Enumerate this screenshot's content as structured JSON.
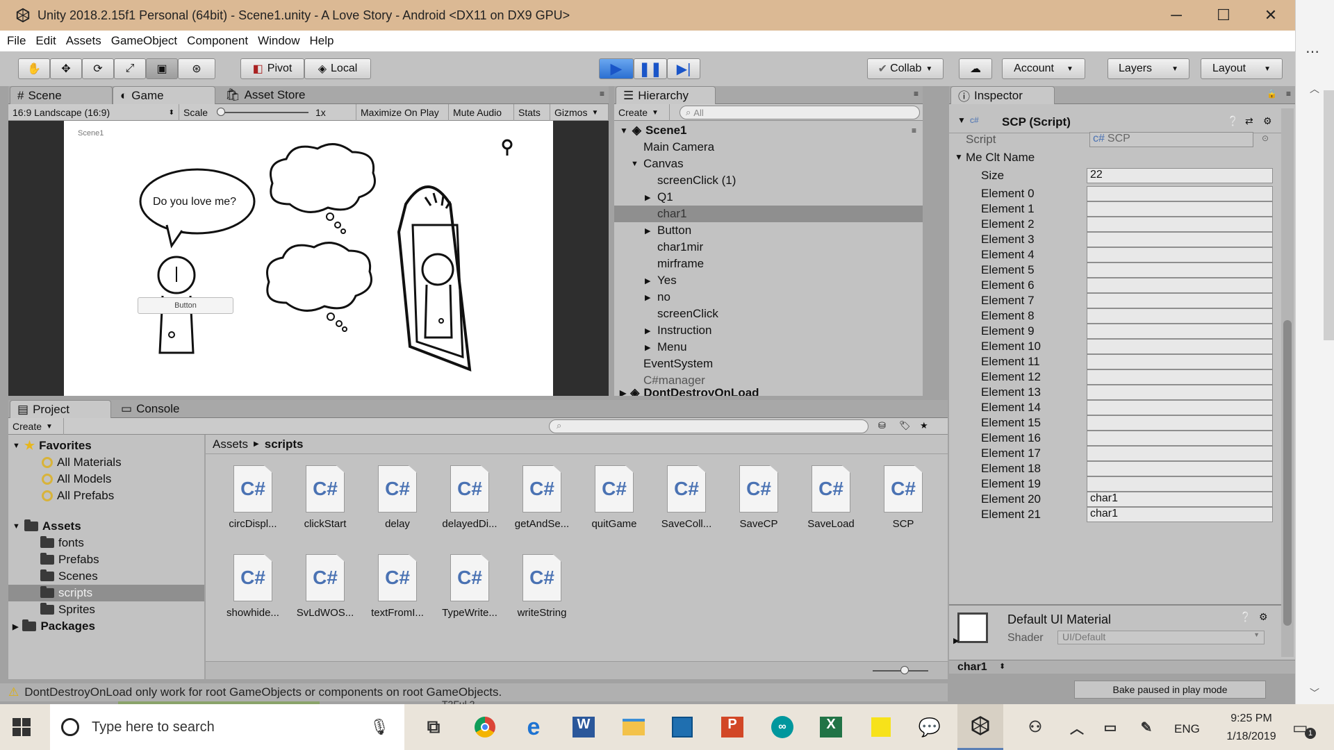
{
  "window": {
    "title": "Unity 2018.2.15f1 Personal (64bit) - Scene1.unity - A Love Story - Android <DX11 on DX9 GPU>",
    "minimize": "─",
    "maximize": "☐",
    "close": "✕"
  },
  "menu": [
    "File",
    "Edit",
    "Assets",
    "GameObject",
    "Component",
    "Window",
    "Help"
  ],
  "toolbar": {
    "pivot": "Pivot",
    "local": "Local",
    "collab": "Collab",
    "account": "Account",
    "layers": "Layers",
    "layout": "Layout"
  },
  "scene_panel": {
    "tabs": [
      "Scene",
      "Game",
      "Asset Store"
    ],
    "aspect": "16:9 Landscape (16:9)",
    "scale_label": "Scale",
    "scale_value": "1x",
    "maximize": "Maximize On Play",
    "mute": "Mute Audio",
    "stats": "Stats",
    "gizmos": "Gizmos",
    "game_label": "Scene1",
    "bubble_text": "Do you love me?",
    "button_text": "Button"
  },
  "hierarchy": {
    "tab": "Hierarchy",
    "create": "Create",
    "search_placeholder": "All",
    "scene": "Scene1",
    "items": [
      {
        "label": "Main Camera",
        "indent": 1,
        "arrow": ""
      },
      {
        "label": "Canvas",
        "indent": 1,
        "arrow": "▼"
      },
      {
        "label": "screenClick (1)",
        "indent": 2,
        "arrow": ""
      },
      {
        "label": "Q1",
        "indent": 2,
        "arrow": "▶"
      },
      {
        "label": "char1",
        "indent": 2,
        "arrow": ""
      },
      {
        "label": "Button",
        "indent": 2,
        "arrow": "▶"
      },
      {
        "label": "char1mir",
        "indent": 2,
        "arrow": ""
      },
      {
        "label": "mirframe",
        "indent": 2,
        "arrow": ""
      },
      {
        "label": "Yes",
        "indent": 2,
        "arrow": "▶"
      },
      {
        "label": "no",
        "indent": 2,
        "arrow": "▶"
      },
      {
        "label": "screenClick",
        "indent": 2,
        "arrow": ""
      },
      {
        "label": "Instruction",
        "indent": 2,
        "arrow": "▶"
      },
      {
        "label": "Menu",
        "indent": 2,
        "arrow": "▶"
      },
      {
        "label": "EventSystem",
        "indent": 1,
        "arrow": ""
      },
      {
        "label": "C#manager",
        "indent": 1,
        "arrow": ""
      }
    ],
    "dont_destroy": "DontDestroyOnLoad"
  },
  "inspector": {
    "tab": "Inspector",
    "component": "SCP (Script)",
    "script_label": "Script",
    "script_value": "SCP",
    "list_name": "Me Clt Name",
    "size_label": "Size",
    "size_value": "22",
    "elements": [
      {
        "label": "Element 0",
        "value": ""
      },
      {
        "label": "Element 1",
        "value": ""
      },
      {
        "label": "Element 2",
        "value": ""
      },
      {
        "label": "Element 3",
        "value": ""
      },
      {
        "label": "Element 4",
        "value": ""
      },
      {
        "label": "Element 5",
        "value": ""
      },
      {
        "label": "Element 6",
        "value": ""
      },
      {
        "label": "Element 7",
        "value": ""
      },
      {
        "label": "Element 8",
        "value": ""
      },
      {
        "label": "Element 9",
        "value": ""
      },
      {
        "label": "Element 10",
        "value": ""
      },
      {
        "label": "Element 11",
        "value": ""
      },
      {
        "label": "Element 12",
        "value": ""
      },
      {
        "label": "Element 13",
        "value": ""
      },
      {
        "label": "Element 14",
        "value": ""
      },
      {
        "label": "Element 15",
        "value": ""
      },
      {
        "label": "Element 16",
        "value": ""
      },
      {
        "label": "Element 17",
        "value": ""
      },
      {
        "label": "Element 18",
        "value": ""
      },
      {
        "label": "Element 19",
        "value": ""
      },
      {
        "label": "Element 20",
        "value": "char1"
      },
      {
        "label": "Element 21",
        "value": "char1"
      }
    ],
    "material": "Default UI Material",
    "shader_label": "Shader",
    "shader_value": "UI/Default",
    "footer": "char1",
    "bake": "Bake paused in play mode"
  },
  "project": {
    "tabs": [
      "Project",
      "Console"
    ],
    "create": "Create",
    "favorites_label": "Favorites",
    "favorites": [
      "All Materials",
      "All Models",
      "All Prefabs"
    ],
    "assets_label": "Assets",
    "folders": [
      "fonts",
      "Prefabs",
      "Scenes",
      "scripts",
      "Sprites"
    ],
    "packages_label": "Packages",
    "breadcrumb_root": "Assets",
    "breadcrumb_leaf": "scripts",
    "file_badge": "C#",
    "files": [
      "circDispl...",
      "clickStart",
      "delay",
      "delayedDi...",
      "getAndSe...",
      "quitGame",
      "SaveColl...",
      "SaveCP",
      "SaveLoad",
      "SCP",
      "showhide...",
      "SvLdWOS...",
      "textFromI...",
      "TypeWrite...",
      "writeString"
    ]
  },
  "status": {
    "warning": "DontDestroyOnLoad only work for root GameObjects or components on root GameObjects."
  },
  "taskbar": {
    "search_placeholder": "Type here to search",
    "lang": "ENG",
    "time": "9:25 PM",
    "date": "1/18/2019",
    "notification_count": "1",
    "desktop_peek": "T2Ful 2"
  },
  "colors": {
    "unity_bg": "#a2a2a2",
    "play_blue": "#2b7de9",
    "titlebar": "#dbb994"
  }
}
